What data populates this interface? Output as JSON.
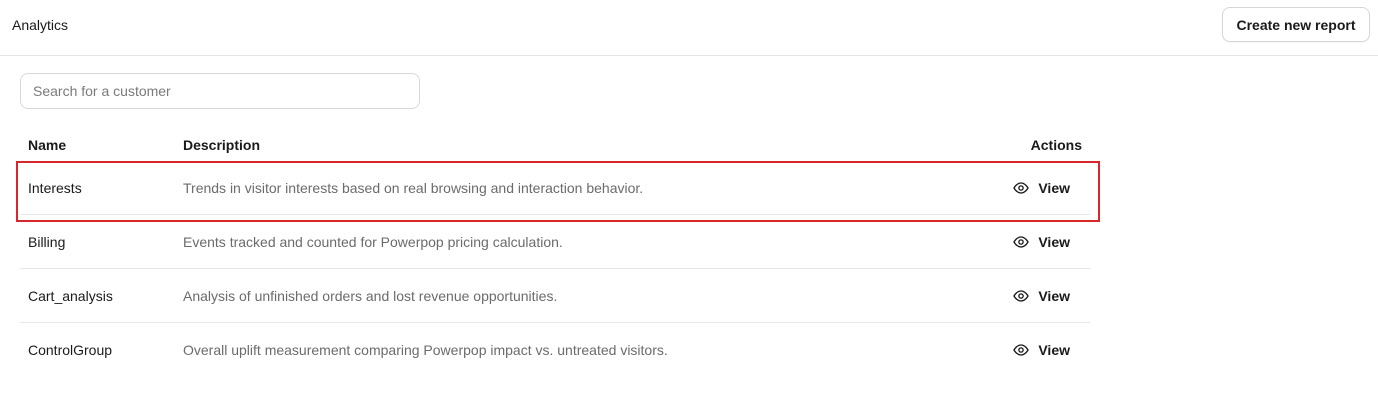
{
  "header": {
    "title": "Analytics",
    "create_button_label": "Create new report"
  },
  "search": {
    "placeholder": "Search for a customer",
    "value": ""
  },
  "table": {
    "columns": {
      "name": "Name",
      "description": "Description",
      "actions": "Actions"
    },
    "rows": [
      {
        "name": "Interests",
        "description": "Trends in visitor interests based on real browsing and interaction behavior.",
        "action_label": "View"
      },
      {
        "name": "Billing",
        "description": "Events tracked and counted for Powerpop pricing calculation.",
        "action_label": "View"
      },
      {
        "name": "Cart_analysis",
        "description": "Analysis of unfinished orders and lost revenue opportunities.",
        "action_label": "View"
      },
      {
        "name": "ControlGroup",
        "description": "Overall uplift measurement comparing Powerpop impact vs. untreated visitors.",
        "action_label": "View"
      }
    ]
  },
  "icons": {
    "view_icon": "eye-icon"
  },
  "colors": {
    "highlight": "#d9262b",
    "divider": "#e6e6e6",
    "muted_text": "#6b6b6b"
  }
}
